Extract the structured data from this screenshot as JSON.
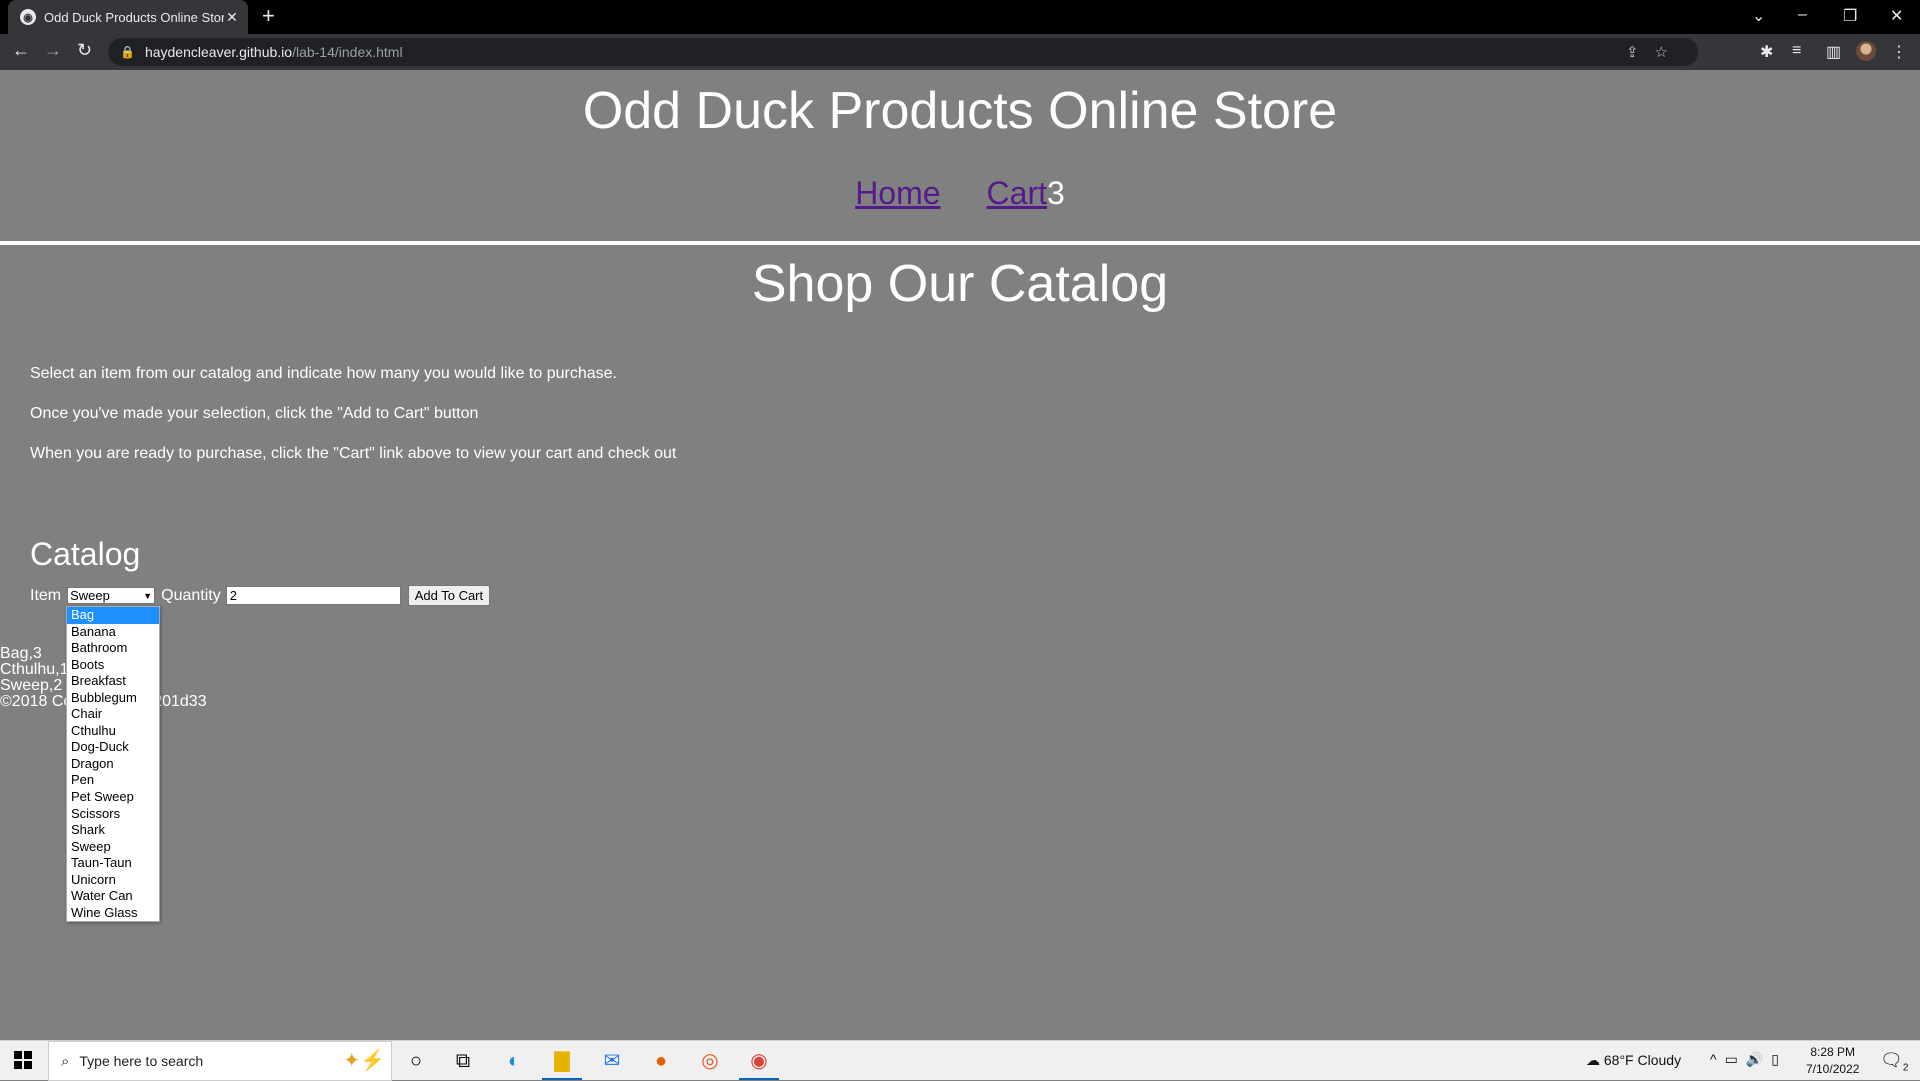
{
  "browser": {
    "tab_title": "Odd Duck Products Online Store",
    "tab_close": "✕",
    "new_tab": "+",
    "url_host": "haydencleaver.github.io",
    "url_path": "/lab-14/index.html"
  },
  "header": {
    "site_title": "Odd Duck Products Online Store",
    "nav_home": "Home",
    "nav_cart": "Cart",
    "cart_count": "3"
  },
  "main": {
    "title": "Shop Our Catalog",
    "instructions": [
      "Select an item from our catalog and indicate how many you would like to purchase.",
      "Once you've made your selection, click the \"Add to Cart\" button",
      "When you are ready to purchase, click the \"Cart\" link above to view your cart and check out"
    ],
    "catalog_heading": "Catalog",
    "item_label": "Item",
    "item_selected": "Sweep",
    "quantity_label": "Quantity",
    "quantity_value": "2",
    "add_button": "Add To Cart"
  },
  "dropdown_options": [
    "Bag",
    "Banana",
    "Bathroom",
    "Boots",
    "Breakfast",
    "Bubblegum",
    "Chair",
    "Cthulhu",
    "Dog-Duck",
    "Dragon",
    "Pen",
    "Pet Sweep",
    "Scissors",
    "Shark",
    "Sweep",
    "Taun-Taun",
    "Unicorn",
    "Water Can",
    "Wine Glass"
  ],
  "dropdown_highlighted": "Bag",
  "cart_summary": [
    "Bag,3",
    "Cthulhu,1",
    "Sweep,2",
    "©2018 Code Fellows 201d33"
  ],
  "taskbar": {
    "search_placeholder": "Type here to search",
    "weather": "68°F  Cloudy",
    "time": "8:28 PM",
    "date": "7/10/2022",
    "notifications": "2"
  },
  "colors": {
    "page_background": "#808080",
    "link": "#551a8b",
    "highlight": "#1e90ff"
  }
}
